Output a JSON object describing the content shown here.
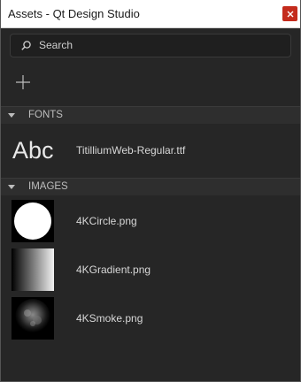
{
  "window": {
    "title": "Assets - Qt Design Studio",
    "close_glyph": "x"
  },
  "search": {
    "placeholder": "Search",
    "icon": "search-icon"
  },
  "toolbar": {
    "add_icon": "plus-icon"
  },
  "sections": {
    "fonts": {
      "label": "FONTS",
      "items": [
        {
          "preview": "Abc",
          "name": "TitilliumWeb-Regular.ttf"
        }
      ]
    },
    "images": {
      "label": "IMAGES",
      "items": [
        {
          "name": "4KCircle.png",
          "thumb": "circle"
        },
        {
          "name": "4KGradient.png",
          "thumb": "gradient"
        },
        {
          "name": "4KSmoke.png",
          "thumb": "smoke"
        }
      ]
    }
  },
  "colors": {
    "background": "#262626",
    "titlebar": "#ffffff",
    "close": "#c42b1c"
  }
}
